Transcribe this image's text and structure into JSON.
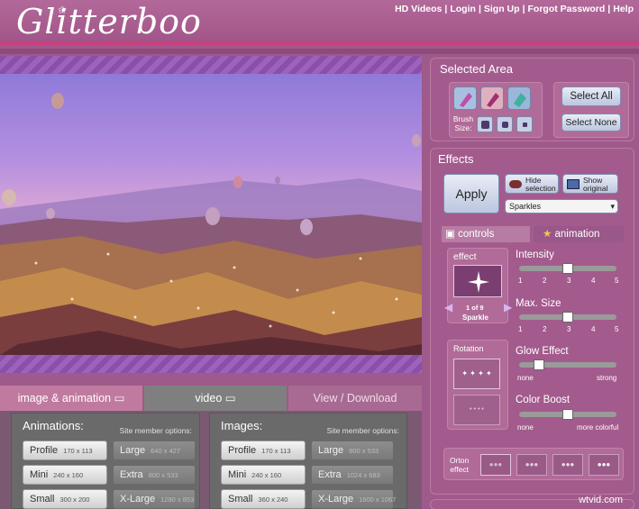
{
  "header": {
    "logo": "Glitterboo",
    "links": [
      "HD Videos",
      "Login",
      "Sign Up",
      "Forgot Password",
      "Help"
    ]
  },
  "tabs": {
    "image_animation": "image & animation",
    "video": "video",
    "download": "View / Download"
  },
  "animations": {
    "title": "Animations:",
    "sub": "Site member options:",
    "free": [
      {
        "label": "Profile",
        "size": "170 x 113"
      },
      {
        "label": "Mini",
        "size": "240 x 160"
      },
      {
        "label": "Small",
        "size": "300 x 200"
      }
    ],
    "member": [
      {
        "label": "Large",
        "size": "640 x 427"
      },
      {
        "label": "Extra",
        "size": "800 x 533"
      },
      {
        "label": "X-Large",
        "size": "1280 x 853"
      }
    ]
  },
  "images": {
    "title": "Images:",
    "sub": "Site member options:",
    "free": [
      {
        "label": "Profile",
        "size": "170 x 113"
      },
      {
        "label": "Mini",
        "size": "240 x 160"
      },
      {
        "label": "Small",
        "size": "360 x 240"
      }
    ],
    "member": [
      {
        "label": "Large",
        "size": "800 x 533"
      },
      {
        "label": "Extra",
        "size": "1024 x 683"
      },
      {
        "label": "X-Large",
        "size": "1600 x 1067"
      }
    ]
  },
  "selected_area": {
    "title": "Selected Area",
    "brush_label_1": "Brush",
    "brush_label_2": "Size:",
    "select_all": "Select All",
    "select_none": "Select None"
  },
  "effects": {
    "title": "Effects",
    "apply": "Apply",
    "hide_1": "Hide",
    "hide_2": "selection",
    "show_1": "Show",
    "show_2": "original",
    "effect_select": "Sparkles",
    "tab_controls": "controls",
    "tab_animation": "animation",
    "effect_label": "effect",
    "effect_counter": "1 of 9",
    "effect_name": "Sparkle",
    "rotation_label": "Rotation",
    "intensity_label": "Intensity",
    "intensity_value": 3,
    "maxsize_label": "Max. Size",
    "maxsize_value": 3,
    "ticks": [
      "1",
      "2",
      "3",
      "4",
      "5"
    ],
    "glow_label": "Glow Effect",
    "glow_min": "none",
    "glow_max": "strong",
    "glow_value": 0.2,
    "boost_label": "Color Boost",
    "boost_min": "none",
    "boost_max": "more colorful",
    "boost_value": 0.5,
    "orton_1": "Orton",
    "orton_2": "effect"
  },
  "watermark": "wtvid.com"
}
